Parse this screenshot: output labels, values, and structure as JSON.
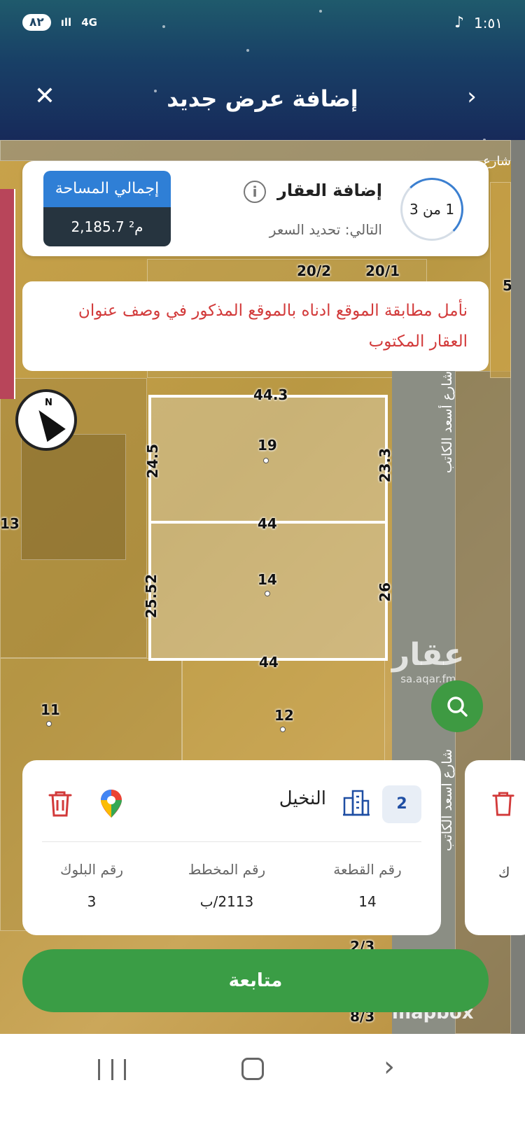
{
  "status_bar": {
    "battery": "٨٢",
    "network": "4G",
    "time": "1:٥١",
    "app_icon": "tiktok-icon"
  },
  "header": {
    "title": "إضافة عرض جديد",
    "close_icon": "close-icon",
    "next_icon": "chevron-right-icon"
  },
  "step_card": {
    "step_counter": "1 من 3",
    "title": "إضافة العقار",
    "next_label": "التالي: تحديد السعر",
    "area_label": "إجمالي المساحة",
    "area_value": "2,185.7 م²"
  },
  "warning": {
    "text": "نأمل مطابقة الموقع ادناه بالموقع المذكور في وصف عنوان العقار المكتوب"
  },
  "map": {
    "street_name": "شارع أسعد الكاتب",
    "street_name_top": "شارع",
    "labels": {
      "p_20_2": "20/2",
      "p_20_1": "20/1",
      "top_edge": "44.3",
      "left_edge_top": "24.5",
      "right_edge_top": "23.3",
      "parcel_top": "19",
      "divider": "44",
      "parcel_bottom": "14",
      "left_edge_bottom": "25.52",
      "right_edge_bottom": "26",
      "bottom_edge": "44",
      "p_11": "11",
      "p_12": "12",
      "p_13": "13",
      "p_5": "5",
      "p_8_3": "8/3",
      "p_2_3": "2/3"
    },
    "watermark_main": "عقار",
    "watermark_url": "sa.aqar.fm",
    "attribution": "mapbox",
    "compass_n": "N"
  },
  "parcel_card": {
    "number": "2",
    "district": "النخيل",
    "columns": [
      {
        "label": "رقم القطعة",
        "value": "14"
      },
      {
        "label": "رقم المخطط",
        "value": "2113/ب"
      },
      {
        "label": "رقم البلوك",
        "value": "3"
      }
    ]
  },
  "peek_card": {
    "partial_text": "ك"
  },
  "continue_button": "متابعة",
  "colors": {
    "primary_green": "#3a9d45",
    "accent_blue": "#2f7fd6",
    "warning_red": "#d23a3a",
    "header_navy": "#172a5a"
  }
}
